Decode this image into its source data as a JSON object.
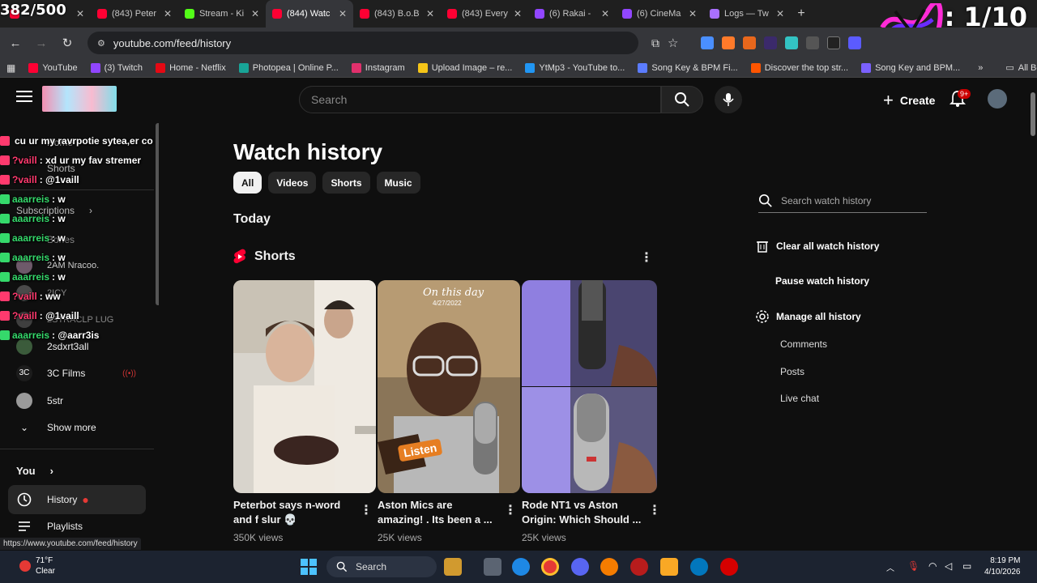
{
  "overlay": {
    "counter_left": "382/500",
    "counter_right": ": 1/10"
  },
  "tabs": [
    {
      "label": "",
      "color": "#ff0033"
    },
    {
      "label": "(843) Peter",
      "color": "#ff0033"
    },
    {
      "label": "Stream - Ki",
      "color": "#53fc18"
    },
    {
      "label": "(844) Watc",
      "color": "#ff0033",
      "active": true
    },
    {
      "label": "(843) B.o.B",
      "color": "#ff0033"
    },
    {
      "label": "(843) Every",
      "color": "#ff0033"
    },
    {
      "label": "(6) Rakai -",
      "color": "#9146ff"
    },
    {
      "label": "(6) CineMa",
      "color": "#9146ff"
    },
    {
      "label": "Logs — Tw",
      "color": "#a970ff"
    }
  ],
  "address": {
    "url": "youtube.com/feed/history"
  },
  "bookmarks": [
    {
      "label": "YouTube",
      "color": "#ff0033"
    },
    {
      "label": "(3) Twitch",
      "color": "#9146ff"
    },
    {
      "label": "Home - Netflix",
      "color": "#e50914"
    },
    {
      "label": "Photopea | Online P...",
      "color": "#18a497"
    },
    {
      "label": "Instagram",
      "color": "#e1306c"
    },
    {
      "label": "Upload Image – re...",
      "color": "#f5c518"
    },
    {
      "label": "YtMp3 - YouTube to...",
      "color": "#2196f3"
    },
    {
      "label": "Song Key & BPM Fi...",
      "color": "#5b7cff"
    },
    {
      "label": "Discover the top str...",
      "color": "#ff5500"
    },
    {
      "label": "Song Key and BPM...",
      "color": "#7b61ff"
    }
  ],
  "all_bookmarks": "All Bookmarks",
  "header": {
    "search_placeholder": "Search",
    "create_label": "Create",
    "notif_count": "9+"
  },
  "chat": [
    {
      "user": "",
      "msg": "cu ur my ravrpotie sytea,er co",
      "kind": "u2"
    },
    {
      "user": "?vaill",
      "msg": ": xd ur my fav stremer",
      "kind": "u2"
    },
    {
      "user": "?vaill",
      "msg": ": @1vaill",
      "kind": "u2"
    },
    {
      "user": "aaarreis",
      "msg": ": w",
      "kind": "u"
    },
    {
      "user": "aaarreis",
      "msg": ": w",
      "kind": "u"
    },
    {
      "user": "aaarreis",
      "msg": ": w",
      "kind": "u"
    },
    {
      "user": "aaarreis",
      "msg": ": w",
      "kind": "u"
    },
    {
      "user": "aaarreis",
      "msg": ": w",
      "kind": "u"
    },
    {
      "user": "?vaill",
      "msg": ": ww",
      "kind": "u2"
    },
    {
      "user": "?vaill",
      "msg": ": @1vaill",
      "kind": "u2"
    },
    {
      "user": "aaarreis",
      "msg": ": @aarr3is",
      "kind": "u"
    }
  ],
  "sidebar": {
    "ghost": [
      "Home",
      "Shorts",
      "Subscriptions",
      "Bones",
      "2AM Nracoo.",
      "2ICY",
      "2STRACLP LUG"
    ],
    "channels": [
      "2sdxrt3all",
      "3C Films",
      "5str"
    ],
    "show_more": "Show more",
    "you": "You",
    "history": "History",
    "playlists": "Playlists"
  },
  "page": {
    "title": "Watch history",
    "chips": [
      "All",
      "Videos",
      "Shorts",
      "Music"
    ],
    "today": "Today",
    "shorts_heading": "Shorts"
  },
  "shorts": [
    {
      "title1": "Peterbot says n-word",
      "title2": "and f slur 💀",
      "views": "350K views"
    },
    {
      "title1": "Aston Mics are",
      "title2": "amazing! . Its been a ...",
      "views": "25K views",
      "overlay_top": "On this day",
      "overlay_date": "4/27/2022",
      "overlay_badge": "Listen"
    },
    {
      "title1": "Rode NT1 vs Aston",
      "title2": "Origin: Which Should ...",
      "views": "25K views"
    }
  ],
  "right_panel": {
    "search_placeholder": "Search watch history",
    "clear": "Clear all watch history",
    "pause": "Pause watch history",
    "manage": "Manage all history",
    "comments": "Comments",
    "posts": "Posts",
    "live_chat": "Live chat"
  },
  "status_url": "https://www.youtube.com/feed/history",
  "taskbar": {
    "temp": "71°F",
    "cond": "Clear",
    "search": "Search",
    "time": "8:19 PM",
    "date": "4/10/2026"
  }
}
